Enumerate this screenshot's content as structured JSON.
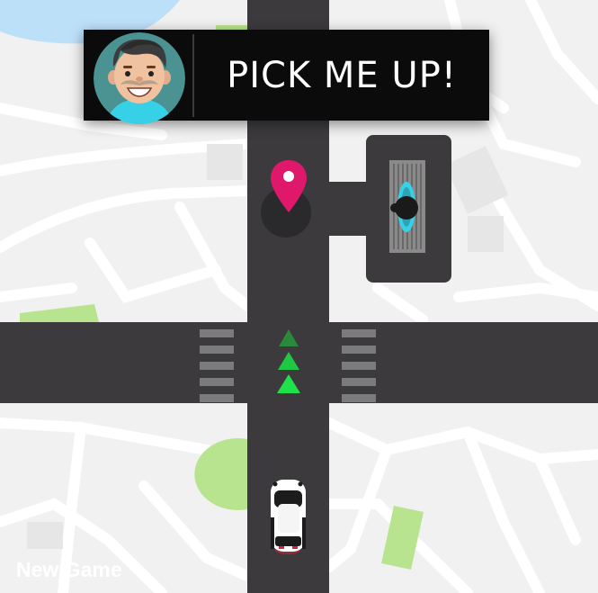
{
  "banner": {
    "message": "PICK ME UP!",
    "avatar_icon": "smiling-man-avatar"
  },
  "controls": {
    "new_game_label": "New Game"
  },
  "colors": {
    "road": "#3c3a3d",
    "ground": "#f1f1f1",
    "park": "#b9e48f",
    "water": "#bde0f9",
    "pin": "#e0186b",
    "arrow_bright": "#1fe24b",
    "arrow_dim": "#2a8a3c",
    "passenger_shirt": "#36d1e6"
  },
  "icons": {
    "pickup": "map-pin-icon",
    "direction": "up-arrow-icon",
    "player": "car-icon",
    "passenger": "passenger-icon"
  }
}
